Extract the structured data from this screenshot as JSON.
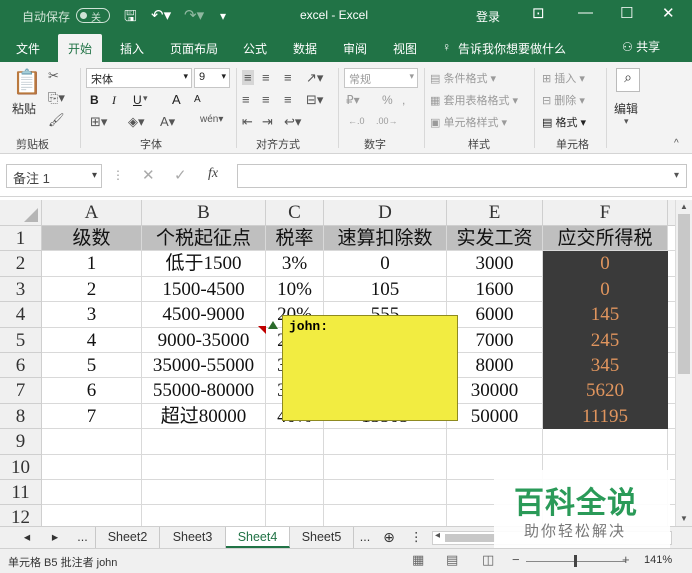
{
  "titlebar": {
    "autosave_label": "自动保存",
    "autosave_state": "关",
    "title": "excel - Excel",
    "login": "登录"
  },
  "tabs": [
    "文件",
    "开始",
    "插入",
    "页面布局",
    "公式",
    "数据",
    "审阅",
    "视图"
  ],
  "active_tab": "开始",
  "tell_me": "告诉我你想要做什么",
  "share": "共享",
  "ribbon": {
    "clipboard": {
      "paste": "粘贴",
      "group": "剪贴板"
    },
    "font": {
      "name": "宋体",
      "size": "9",
      "bold": "B",
      "italic": "I",
      "underline": "U",
      "grow": "A",
      "shrink": "A",
      "group": "字体"
    },
    "alignment": {
      "group": "对齐方式"
    },
    "number": {
      "format": "常规",
      "percent": "%",
      "comma": ",",
      "group": "数字"
    },
    "styles": {
      "conditional": "条件格式",
      "table": "套用表格格式",
      "cell": "单元格样式",
      "group": "样式"
    },
    "cells": {
      "insert": "插入",
      "delete": "删除",
      "format": "格式",
      "group": "单元格"
    },
    "editing": {
      "label": "编辑"
    }
  },
  "name_box": "备注 1",
  "formula": "",
  "columns": [
    "A",
    "B",
    "C",
    "D",
    "E",
    "F"
  ],
  "rows": [
    {
      "num": "1",
      "cells": [
        "级数",
        "个税起征点",
        "税率",
        "速算扣除数",
        "实发工资",
        "应交所得税"
      ]
    },
    {
      "num": "2",
      "cells": [
        "1",
        "低于1500",
        "3%",
        "0",
        "3000",
        "0"
      ]
    },
    {
      "num": "3",
      "cells": [
        "2",
        "1500-4500",
        "10%",
        "105",
        "1600",
        "0"
      ]
    },
    {
      "num": "4",
      "cells": [
        "3",
        "4500-9000",
        "20%",
        "555",
        "6000",
        "145"
      ]
    },
    {
      "num": "5",
      "cells": [
        "4",
        "9000-35000",
        "25%",
        "1005",
        "7000",
        "245"
      ]
    },
    {
      "num": "6",
      "cells": [
        "5",
        "35000-55000",
        "30%",
        "2755",
        "8000",
        "345"
      ]
    },
    {
      "num": "7",
      "cells": [
        "6",
        "55000-80000",
        "35%",
        "5505",
        "30000",
        "5620"
      ]
    },
    {
      "num": "8",
      "cells": [
        "7",
        "超过80000",
        "40%",
        "13505",
        "50000",
        "11195"
      ]
    },
    {
      "num": "9",
      "cells": [
        "",
        "",
        "",
        "",
        "",
        ""
      ]
    },
    {
      "num": "10",
      "cells": [
        "",
        "",
        "",
        "",
        "",
        ""
      ]
    },
    {
      "num": "11",
      "cells": [
        "",
        "",
        "",
        "",
        "",
        ""
      ]
    },
    {
      "num": "12",
      "cells": [
        "",
        "",
        "",
        "",
        "",
        ""
      ]
    }
  ],
  "comment": {
    "author": "john:"
  },
  "sheets": [
    "Sheet2",
    "Sheet3",
    "Sheet4",
    "Sheet5"
  ],
  "active_sheet": "Sheet4",
  "sheet_ellipsis": "...",
  "status": {
    "text": "单元格 B5 批注者 john",
    "zoom": "141%"
  },
  "watermark": {
    "title": "百科全说",
    "subtitle": "助你轻松解决"
  },
  "colors": {
    "excel_green": "#217346",
    "header_fill": "#bfbfbf",
    "dark_fill": "#3a3a3a",
    "orange_text": "#e0955e",
    "comment_yellow": "#f2ec41"
  }
}
